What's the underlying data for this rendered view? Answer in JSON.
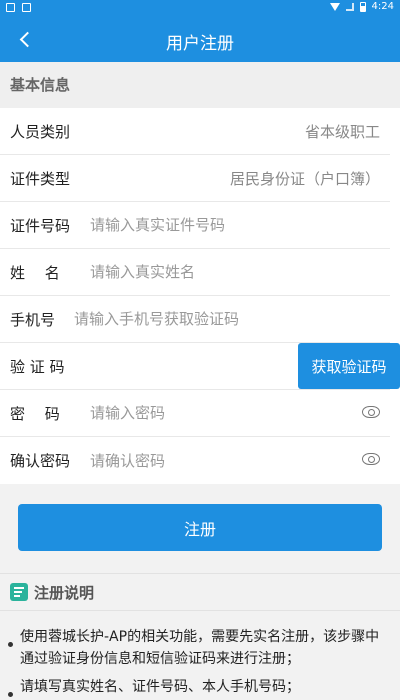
{
  "status_bar": {
    "time": "4:24"
  },
  "header": {
    "title": "用户注册"
  },
  "section": {
    "title": "基本信息"
  },
  "form": {
    "person_type": {
      "label": "人员类别",
      "value": "省本级职工"
    },
    "id_type": {
      "label": "证件类型",
      "value": "居民身份证（户口簿）"
    },
    "id_number": {
      "label": "证件号码",
      "placeholder": "请输入真实证件号码"
    },
    "name": {
      "label": "姓　 名",
      "placeholder": "请输入真实姓名"
    },
    "phone": {
      "label": "手机号",
      "placeholder": "请输入手机号获取验证码"
    },
    "code": {
      "label": "验 证 码",
      "button": "获取验证码"
    },
    "password": {
      "label": "密　 码",
      "placeholder": "请输入密码"
    },
    "confirm_password": {
      "label": "确认密码",
      "placeholder": "请确认密码"
    }
  },
  "submit_label": "注册",
  "notes": {
    "title": "注册说明",
    "items": [
      "使用蓉城长护-AP的相关功能，需要先实名注册，该步骤中通过验证身份信息和短信验证码来进行注册；",
      "请填写真实姓名、证件号码、本人手机号码；"
    ]
  },
  "colors": {
    "primary": "#1e8fe0",
    "accent_note": "#2bb39c"
  }
}
